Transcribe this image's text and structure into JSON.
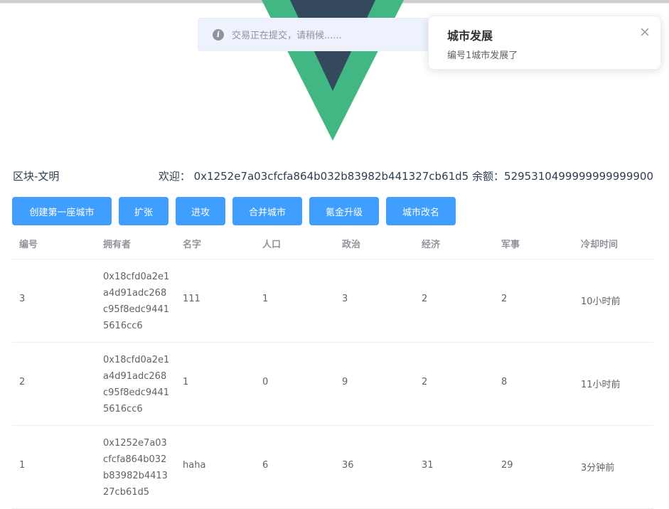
{
  "message": {
    "icon": "info-icon",
    "text": "交易正在提交，请稍候......"
  },
  "notification": {
    "title": "城市发展",
    "body": "编号1城市发展了",
    "close_icon": "close-icon"
  },
  "logo": {
    "name": "vue-logo-icon",
    "colors": [
      "#41b883",
      "#35495e"
    ]
  },
  "header": {
    "brand": "区块-文明",
    "welcome_label": "欢迎：",
    "address": "0x1252e7a03cfcfa864b032b83982b441327cb61d5",
    "balance_label": "余额：",
    "balance": "5295310499999999999900"
  },
  "buttons": [
    "创建第一座城市",
    "扩张",
    "进攻",
    "合并城市",
    "氪金升级",
    "城市改名"
  ],
  "table": {
    "columns": [
      "编号",
      "拥有者",
      "名字",
      "人口",
      "政治",
      "经济",
      "军事",
      "冷却时间"
    ],
    "rows": [
      {
        "id": "3",
        "owner": "0x18cfd0a2e1a4d91adc268c95f8edc94415616cc6",
        "name": "111",
        "population": "1",
        "politics": "3",
        "economy": "2",
        "military": "2",
        "cooldown": "10小时前"
      },
      {
        "id": "2",
        "owner": "0x18cfd0a2e1a4d91adc268c95f8edc94415616cc6",
        "name": "1",
        "population": "0",
        "politics": "9",
        "economy": "2",
        "military": "8",
        "cooldown": "11小时前"
      },
      {
        "id": "1",
        "owner": "0x1252e7a03cfcfa864b032b83982b441327cb61d5",
        "name": "haha",
        "population": "6",
        "politics": "36",
        "economy": "31",
        "military": "29",
        "cooldown": "3分钟前"
      }
    ]
  },
  "colors": {
    "primary": "#409eff",
    "message_bg": "#edf2fc",
    "vue_green": "#41b883",
    "vue_dark": "#35495e"
  }
}
